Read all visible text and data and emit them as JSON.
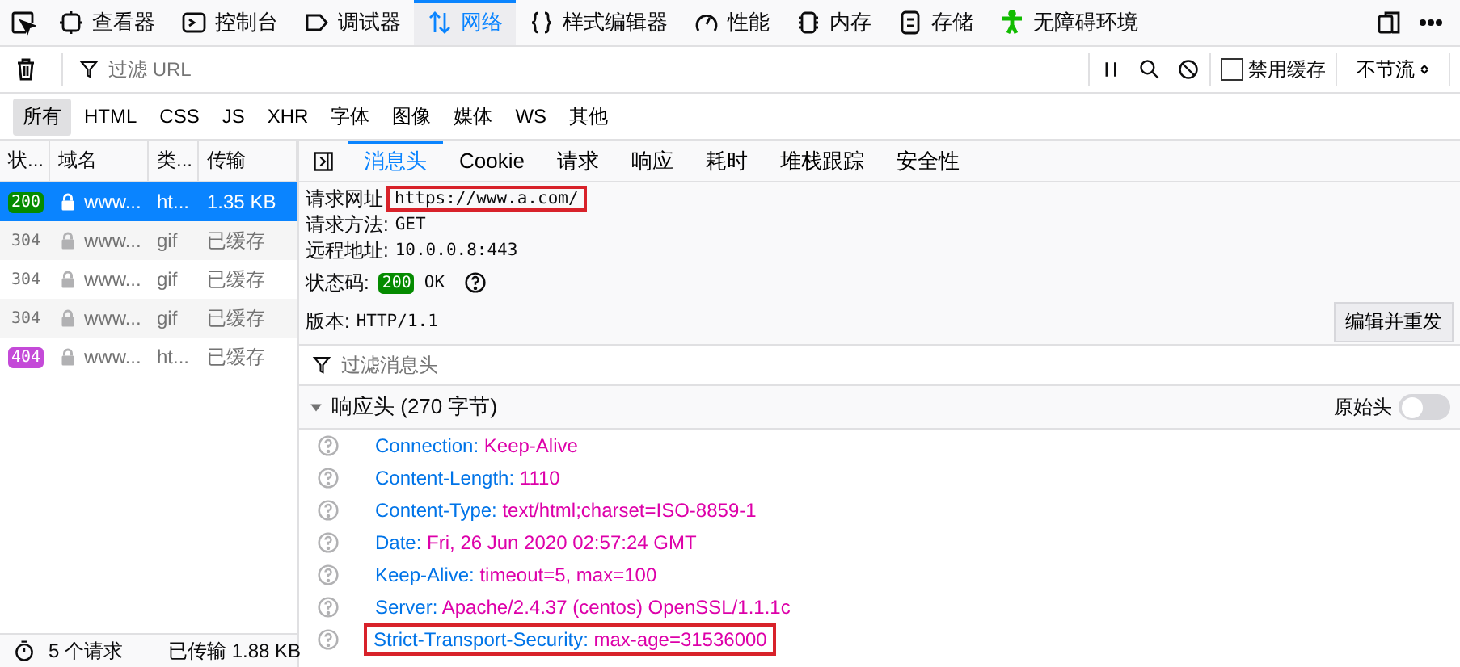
{
  "toolbar": {
    "tabs": [
      {
        "label": "查看器",
        "kind": "inspector",
        "selected": false
      },
      {
        "label": "控制台",
        "kind": "console",
        "selected": false
      },
      {
        "label": "调试器",
        "kind": "debugger",
        "selected": false
      },
      {
        "label": "网络",
        "kind": "network",
        "selected": true
      },
      {
        "label": "样式编辑器",
        "kind": "style",
        "selected": false
      },
      {
        "label": "性能",
        "kind": "performance",
        "selected": false
      },
      {
        "label": "内存",
        "kind": "memory",
        "selected": false
      },
      {
        "label": "存储",
        "kind": "storage",
        "selected": false
      },
      {
        "label": "无障碍环境",
        "kind": "accessibility",
        "selected": false
      }
    ]
  },
  "filter_bar": {
    "placeholder": "过滤 URL",
    "disable_cache": {
      "label": "禁用缓存",
      "checked": false
    },
    "throttle": "不节流"
  },
  "type_filters": [
    {
      "label": "所有",
      "selected": true
    },
    {
      "label": "HTML",
      "selected": false
    },
    {
      "label": "CSS",
      "selected": false
    },
    {
      "label": "JS",
      "selected": false
    },
    {
      "label": "XHR",
      "selected": false
    },
    {
      "label": "字体",
      "selected": false
    },
    {
      "label": "图像",
      "selected": false
    },
    {
      "label": "媒体",
      "selected": false
    },
    {
      "label": "WS",
      "selected": false
    },
    {
      "label": "其他",
      "selected": false
    }
  ],
  "requests": {
    "columns": [
      "状...",
      "域名",
      "类...",
      "传输"
    ],
    "rows": [
      {
        "status": "200",
        "kind": "ok",
        "domain": "www...",
        "type": "ht...",
        "transfer": "1.35 KB",
        "selected": true
      },
      {
        "status": "304",
        "kind": "cached",
        "domain": "www...",
        "type": "gif",
        "transfer": "已缓存",
        "selected": false
      },
      {
        "status": "304",
        "kind": "cached",
        "domain": "www...",
        "type": "gif",
        "transfer": "已缓存",
        "selected": false
      },
      {
        "status": "304",
        "kind": "cached",
        "domain": "www...",
        "type": "gif",
        "transfer": "已缓存",
        "selected": false
      },
      {
        "status": "404",
        "kind": "error",
        "domain": "www...",
        "type": "ht...",
        "transfer": "已缓存",
        "selected": false
      }
    ]
  },
  "status_bar": {
    "requests": "5 个请求",
    "transferred": "已传输 1.88 KB"
  },
  "detail_tabs": [
    {
      "label": "消息头",
      "selected": true
    },
    {
      "label": "Cookie",
      "selected": false
    },
    {
      "label": "请求",
      "selected": false
    },
    {
      "label": "响应",
      "selected": false
    },
    {
      "label": "耗时",
      "selected": false
    },
    {
      "label": "堆栈跟踪",
      "selected": false
    },
    {
      "label": "安全性",
      "selected": false
    }
  ],
  "summary": {
    "fields": [
      {
        "label": "请求网址",
        "value": "https://www.a.com/",
        "highlighted": true
      },
      {
        "label": "请求方法:",
        "value": "GET",
        "highlighted": false
      },
      {
        "label": "远程地址:",
        "value": "10.0.0.8:443",
        "highlighted": false
      }
    ],
    "status": {
      "label": "状态码:",
      "code": "200",
      "text": "OK"
    },
    "version": {
      "label": "版本:",
      "value": "HTTP/1.1"
    },
    "resend_button": "编辑并重发"
  },
  "header_filter": {
    "placeholder": "过滤消息头"
  },
  "response_headers": {
    "title": "响应头 (270 字节)",
    "expanded": true,
    "raw_toggle": {
      "label": "原始头",
      "on": false
    },
    "items": [
      {
        "name": "Connection:",
        "value": "Keep-Alive",
        "highlighted": false
      },
      {
        "name": "Content-Length:",
        "value": "1110",
        "highlighted": false
      },
      {
        "name": "Content-Type:",
        "value": "text/html;charset=ISO-8859-1",
        "highlighted": false
      },
      {
        "name": "Date:",
        "value": "Fri, 26 Jun 2020 02:57:24 GMT",
        "highlighted": false
      },
      {
        "name": "Keep-Alive:",
        "value": "timeout=5, max=100",
        "highlighted": false
      },
      {
        "name": "Server:",
        "value": "Apache/2.4.37 (centos) OpenSSL/1.1.1c",
        "highlighted": false
      },
      {
        "name": "Strict-Transport-Security:",
        "value": "max-age=31536000",
        "highlighted": true
      }
    ]
  }
}
